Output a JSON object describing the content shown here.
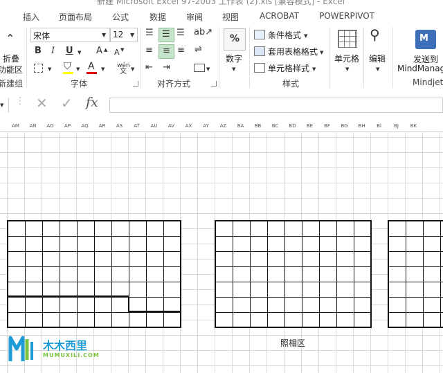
{
  "window": {
    "title": "新建 Microsoft Excel 97-2003 工作表 (2).xls [兼容模式] - Excel"
  },
  "tabs": [
    "插入",
    "页面布局",
    "公式",
    "数据",
    "审阅",
    "视图",
    "ACROBAT",
    "POWERPIVOT"
  ],
  "ribbon": {
    "collapse": {
      "line1": "折叠",
      "line2": "功能区",
      "group": "新建组"
    },
    "font": {
      "name": "宋体",
      "size": "12",
      "group": "字体",
      "bold": "B",
      "italic": "I",
      "underline": "U",
      "grow": "A",
      "shrink": "A",
      "color_letter": "A",
      "phonetic": "wén"
    },
    "alignment": {
      "group": "对齐方式"
    },
    "number": {
      "label": "数字",
      "symbol": "%"
    },
    "styles": {
      "group": "样式",
      "conditional": "条件格式",
      "table": "套用表格格式",
      "cell": "单元格样式"
    },
    "cells": {
      "label": "单元格"
    },
    "editing": {
      "label": "编辑"
    },
    "mindjet": {
      "line1": "发送到",
      "line2": "MindManager",
      "group": "Mindjet"
    }
  },
  "formula_bar": {
    "fx": "fx",
    "value": ""
  },
  "columns": [
    "AM",
    "AN",
    "AO",
    "AP",
    "AQ",
    "AR",
    "AS",
    "AT",
    "AU",
    "AV",
    "AX",
    "AY",
    "AZ",
    "BA",
    "BB",
    "BC",
    "BD",
    "BE",
    "BF",
    "BG",
    "BH",
    "BI",
    "BJ",
    "BK"
  ],
  "sheet": {
    "caption": "照相区"
  },
  "watermark": {
    "brand": "木木西里",
    "url": "MUMUXILI.COM"
  },
  "colors": {
    "accent": "#217346",
    "grid": "#dadada",
    "selection": "#c5e3c9",
    "logo": "#1f9bd7"
  }
}
